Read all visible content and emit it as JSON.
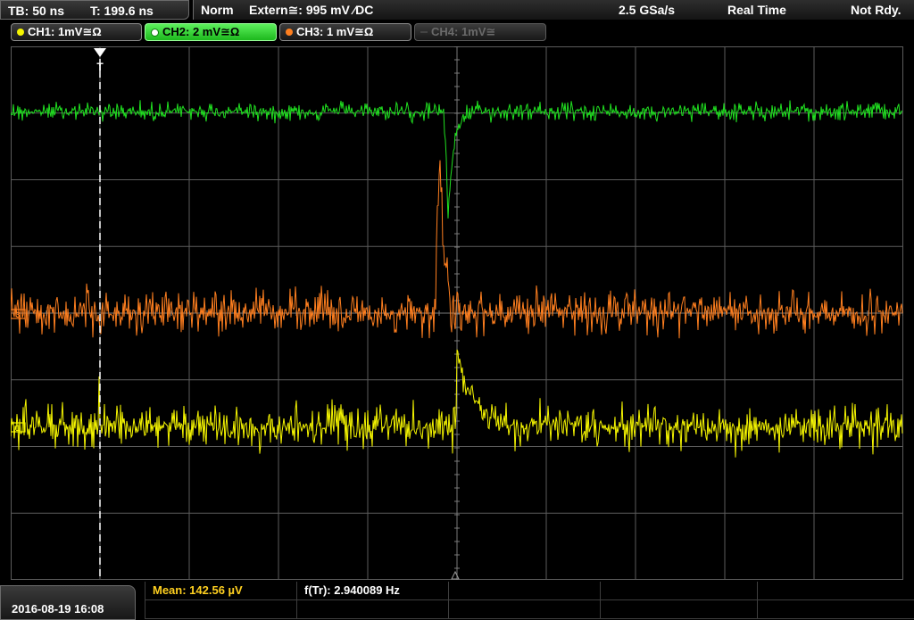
{
  "timebase": {
    "tb": "TB: 50 ns",
    "t": "T: 199.6 ns"
  },
  "status": {
    "mode": "Norm",
    "trigger": "Extern≅: 995 mV ⁄DC",
    "sample_rate": "2.5 GSa/s",
    "acq": "Real Time",
    "state": "Not Rdy."
  },
  "channels": [
    {
      "label": "CH1: 1mV≅Ω",
      "color": "#f5f500",
      "state": "on"
    },
    {
      "label": "CH2: 2 mV≅Ω",
      "color": "#20e020",
      "state": "active"
    },
    {
      "label": "CH3: 1 mV≅Ω",
      "color": "#ff7f1f",
      "state": "on"
    },
    {
      "label": "CH4: 1mV≅",
      "color": "#555555",
      "state": "off"
    }
  ],
  "markers": {
    "trigger": "T",
    "ch_marker": "1"
  },
  "timestamp": "2016-08-19 16:08",
  "measurements": {
    "mean": "Mean: 142.56 µV",
    "freq": "f(Tr): 2.940089 Hz"
  },
  "colors": {
    "ch1": "#f5f500",
    "ch2": "#20e020",
    "ch3": "#ff7f1f",
    "grid": "#5c5c5c",
    "accent": "#ffd020"
  }
}
